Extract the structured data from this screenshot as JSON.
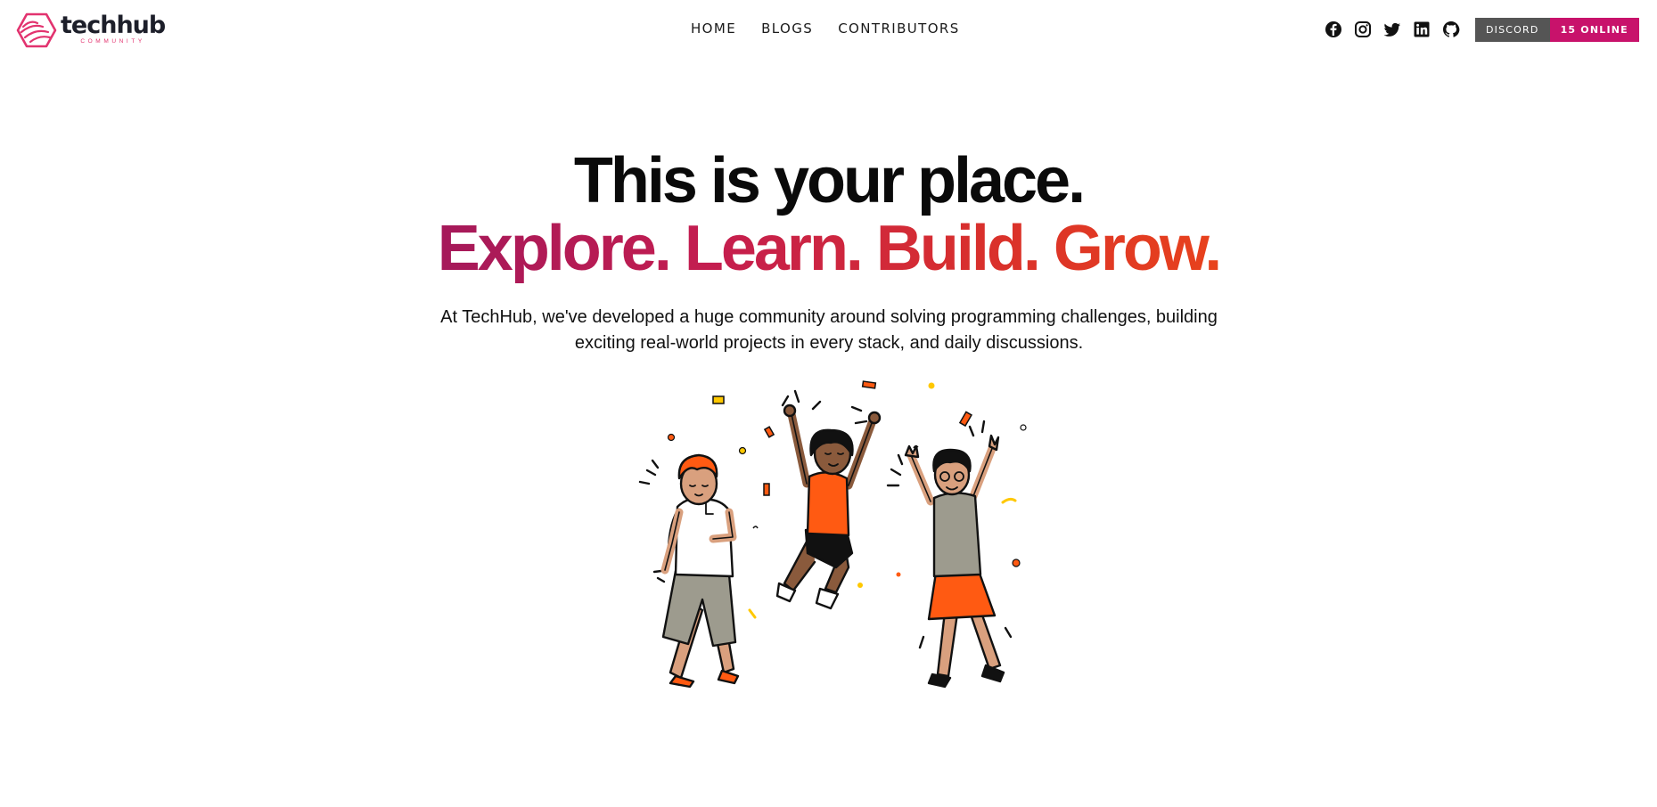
{
  "brand": {
    "name": "techhub",
    "subtitle": "COMMUNITY",
    "colors": {
      "mark": "#e2336f",
      "name": "#1d1f2a"
    }
  },
  "nav": {
    "items": [
      {
        "label": "HOME"
      },
      {
        "label": "BLOGS"
      },
      {
        "label": "CONTRIBUTORS"
      }
    ]
  },
  "social": {
    "icons": [
      "facebook-icon",
      "instagram-icon",
      "twitter-icon",
      "linkedin-icon",
      "github-icon"
    ]
  },
  "discord": {
    "label": "DISCORD",
    "online": "15 ONLINE",
    "colors": {
      "label_bg": "#555555",
      "count_bg": "#c8126b"
    }
  },
  "hero": {
    "title": "This is your place.",
    "tagline": "Explore. Learn. Build. Grow.",
    "tagline_gradient": [
      "#a5195a",
      "#e8421c"
    ],
    "description": "At TechHub, we've developed a huge community around solving programming challenges, building exciting real-world projects in every stack, and daily discussions."
  },
  "illustration": {
    "subject": "three-people-celebrating",
    "colors": {
      "orange": "#ff5a12",
      "skin_dark": "#8a5a3c",
      "skin_light": "#d9a07e",
      "confetti": "#ffc800"
    }
  }
}
